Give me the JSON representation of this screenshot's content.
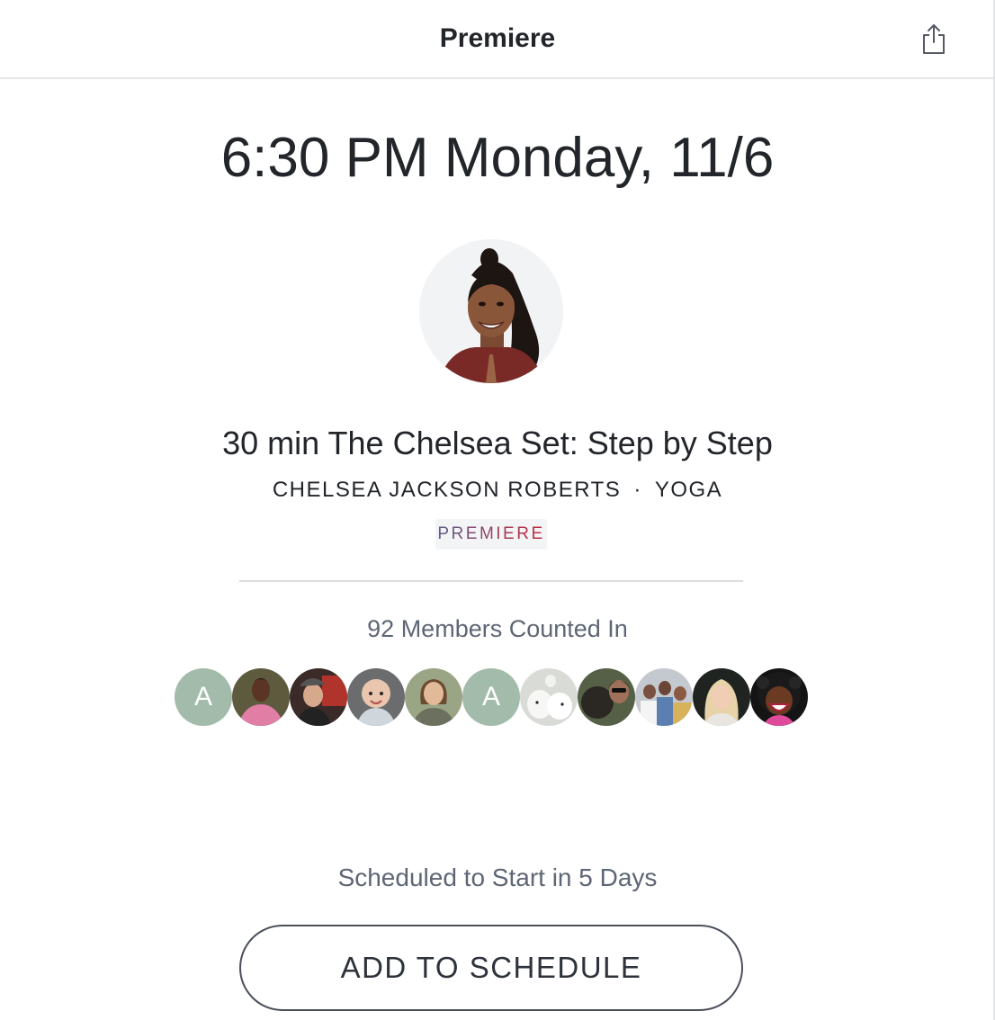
{
  "header": {
    "title": "Premiere",
    "share_icon": "share-icon"
  },
  "class": {
    "datetime": "6:30 PM Monday, 11/6",
    "title": "30 min The Chelsea Set: Step by Step",
    "instructor": "CHELSEA JACKSON ROBERTS",
    "separator": "·",
    "discipline": "YOGA",
    "badge": "PREMIERE"
  },
  "members": {
    "count_text": "92 Members Counted In",
    "avatars": [
      {
        "type": "letter",
        "letter": "A"
      },
      {
        "type": "photo"
      },
      {
        "type": "photo"
      },
      {
        "type": "photo"
      },
      {
        "type": "photo"
      },
      {
        "type": "letter",
        "letter": "A"
      },
      {
        "type": "photo"
      },
      {
        "type": "photo"
      },
      {
        "type": "photo"
      },
      {
        "type": "photo"
      },
      {
        "type": "photo"
      }
    ]
  },
  "schedule": {
    "note": "Scheduled to Start in 5 Days",
    "button_label": "ADD TO SCHEDULE"
  },
  "colors": {
    "letter_avatar": "#a3bbaa",
    "muted_text": "#5e6675",
    "badge_gradient_start": "#5b5f8f",
    "badge_gradient_end": "#c8273f"
  }
}
